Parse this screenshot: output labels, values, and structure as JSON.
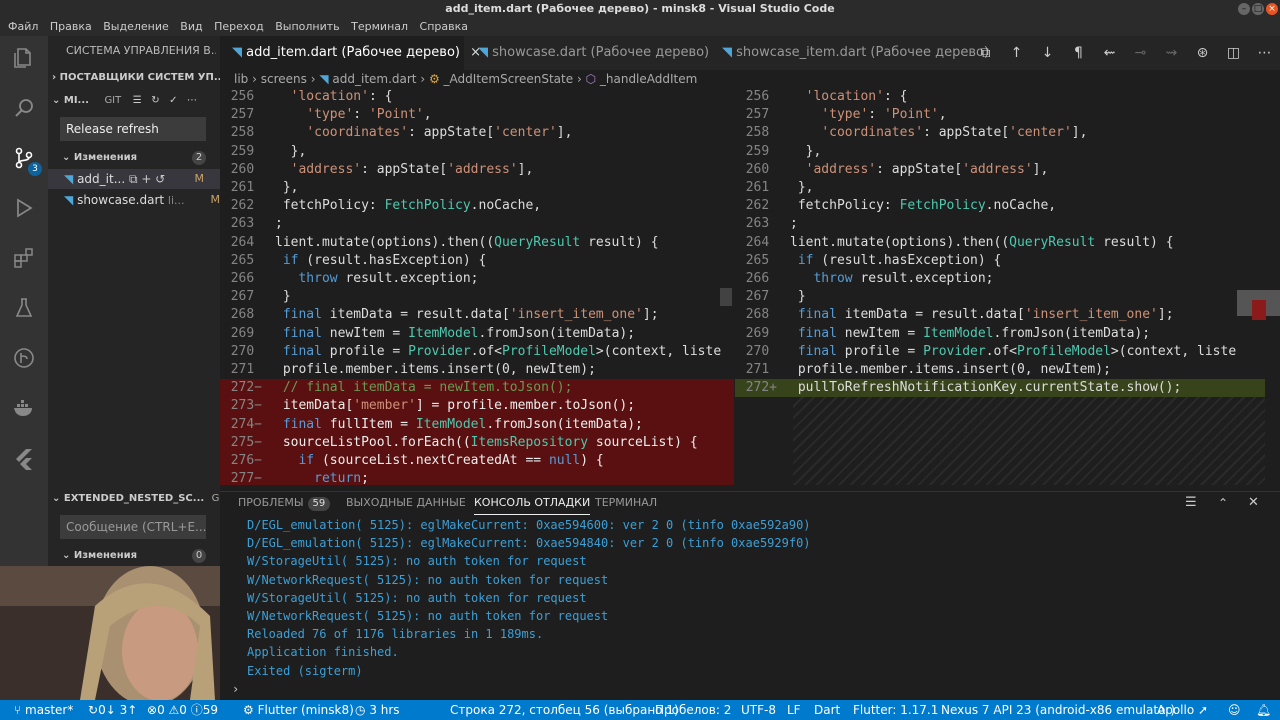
{
  "window": {
    "title": "add_item.dart (Рабочее дерево) - minsk8 - Visual Studio Code"
  },
  "menu": [
    "Файл",
    "Правка",
    "Выделение",
    "Вид",
    "Переход",
    "Выполнить",
    "Терминал",
    "Справка"
  ],
  "activity": {
    "scm_badge": "3"
  },
  "sidebar": {
    "header": "СИСТЕМА УПРАВЛЕНИЯ В...",
    "providers": "ПОСТАВЩИКИ СИСТЕМ УП...",
    "repo1": {
      "name": "MI...",
      "tag": "GIT",
      "message": "Release refresh",
      "changes_label": "Изменения",
      "changes_count": "2",
      "files": [
        {
          "name": "add_it...",
          "status": "M"
        },
        {
          "name": "showcase.dart",
          "dir": "li...",
          "status": "M"
        }
      ]
    },
    "repo2": {
      "name": "EXTENDED_NESTED_SC...",
      "tag": "GIT",
      "placeholder": "Сообщение (CTRL+E...",
      "changes_label": "Изменения",
      "changes_count": "0"
    }
  },
  "tabs": [
    {
      "label": "add_item.dart (Рабочее дерево)",
      "close": "×"
    },
    {
      "label": "showcase.dart (Рабочее дерево)"
    },
    {
      "label": "showcase_item.dart (Рабочее дерево)"
    }
  ],
  "breadcrumb": [
    "lib",
    "screens",
    "add_item.dart",
    "_AddItemScreenState",
    "_handleAddItem"
  ],
  "left_code": [
    {
      "n": "256",
      "t": "  'location': {"
    },
    {
      "n": "257",
      "t": "    'type': 'Point',"
    },
    {
      "n": "258",
      "t": "    'coordinates': appState['center'],"
    },
    {
      "n": "259",
      "t": "  },"
    },
    {
      "n": "260",
      "t": "  'address': appState['address'],"
    },
    {
      "n": "261",
      "t": " },"
    },
    {
      "n": "262",
      "t": " fetchPolicy: FetchPolicy.noCache,"
    },
    {
      "n": "263",
      "t": ";"
    },
    {
      "n": "264",
      "t": "lient.mutate(options).then((QueryResult result) {"
    },
    {
      "n": "265",
      "t": " if (result.hasException) {"
    },
    {
      "n": "266",
      "t": "   throw result.exception;"
    },
    {
      "n": "267",
      "t": " }"
    },
    {
      "n": "268",
      "t": " final itemData = result.data['insert_item_one'];"
    },
    {
      "n": "269",
      "t": " final newItem = ItemModel.fromJson(itemData);"
    },
    {
      "n": "270",
      "t": " final profile = Provider.of<ProfileModel>(context, liste"
    },
    {
      "n": "271",
      "t": " profile.member.items.insert(0, newItem);"
    },
    {
      "n": "272",
      "m": "−",
      "t": " // final itemData = newItem.toJson();"
    },
    {
      "n": "273",
      "m": "−",
      "t": " itemData['member'] = profile.member.toJson();"
    },
    {
      "n": "274",
      "m": "−",
      "t": " final fullItem = ItemModel.fromJson(itemData);"
    },
    {
      "n": "275",
      "m": "−",
      "t": " sourceListPool.forEach((ItemsRepository sourceList) {"
    },
    {
      "n": "276",
      "m": "−",
      "t": "   if (sourceList.nextCreatedAt == null) {"
    },
    {
      "n": "277",
      "m": "−",
      "t": "     return;"
    }
  ],
  "right_code": [
    {
      "n": "256",
      "t": "  'location': {"
    },
    {
      "n": "257",
      "t": "    'type': 'Point',"
    },
    {
      "n": "258",
      "t": "    'coordinates': appState['center'],"
    },
    {
      "n": "259",
      "t": "  },"
    },
    {
      "n": "260",
      "t": "  'address': appState['address'],"
    },
    {
      "n": "261",
      "t": " },"
    },
    {
      "n": "262",
      "t": " fetchPolicy: FetchPolicy.noCache,"
    },
    {
      "n": "263",
      "t": ";"
    },
    {
      "n": "264",
      "t": "lient.mutate(options).then((QueryResult result) {"
    },
    {
      "n": "265",
      "t": " if (result.hasException) {"
    },
    {
      "n": "266",
      "t": "   throw result.exception;"
    },
    {
      "n": "267",
      "t": " }"
    },
    {
      "n": "268",
      "t": " final itemData = result.data['insert_item_one'];"
    },
    {
      "n": "269",
      "t": " final newItem = ItemModel.fromJson(itemData);"
    },
    {
      "n": "270",
      "t": " final profile = Provider.of<ProfileModel>(context, liste"
    },
    {
      "n": "271",
      "t": " profile.member.items.insert(0, newItem);"
    },
    {
      "n": "272",
      "m": "+",
      "t": " pullToRefreshNotificationKey.currentState.show();"
    }
  ],
  "panel": {
    "tabs": [
      "ПРОБЛЕМЫ",
      "ВЫХОДНЫЕ ДАННЫЕ",
      "КОНСОЛЬ ОТЛАДКИ",
      "ТЕРМИНАЛ"
    ],
    "problems_count": "59",
    "lines": [
      "D/EGL_emulation( 5125): eglMakeCurrent: 0xae594600: ver 2 0 (tinfo 0xae592a90)",
      "D/EGL_emulation( 5125): eglMakeCurrent: 0xae594840: ver 2 0 (tinfo 0xae5929f0)",
      "W/StorageUtil( 5125): no auth token for request",
      "W/NetworkRequest( 5125): no auth token for request",
      "W/StorageUtil( 5125): no auth token for request",
      "W/NetworkRequest( 5125): no auth token for request",
      "Reloaded 76 of 1176 libraries in 1 189ms.",
      "Application finished.",
      "Exited (sigterm)"
    ],
    "prompt": "›"
  },
  "status": {
    "branch": "master*",
    "sync": "0↓ 3↑",
    "errors": "0",
    "warnings": "0",
    "infos": "59",
    "flutter": "Flutter (minsk8)",
    "time": "3 hrs",
    "position": "Строка 272, столбец 56 (выбрано 1)",
    "spaces": "Пробелов: 2",
    "encoding": "UTF-8",
    "eol": "LF",
    "language": "Dart",
    "flutter_version": "Flutter: 1.17.1",
    "device": "Nexus 7 API 23 (android-x86 emulator)",
    "apollo": "Apollo"
  }
}
